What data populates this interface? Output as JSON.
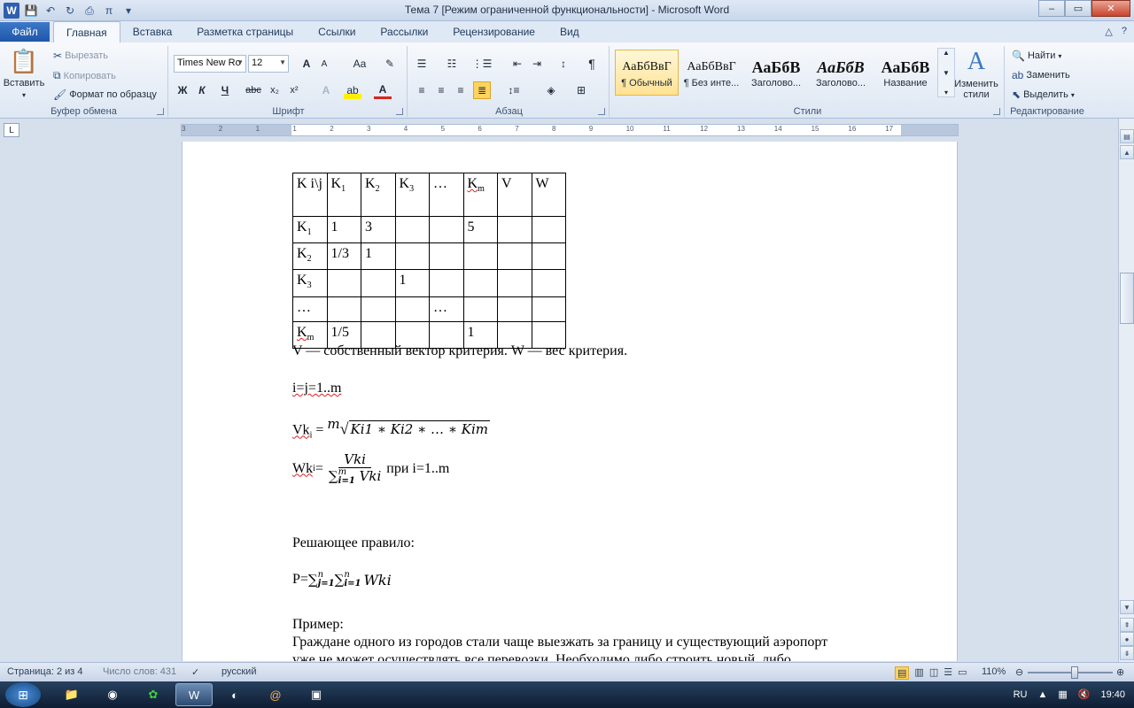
{
  "window": {
    "title": "Тема 7 [Режим ограниченной функциональности]  -  Microsoft Word",
    "minimize": "–",
    "maximize": "▭",
    "close": "✕"
  },
  "tabs": {
    "file": "Файл",
    "items": [
      "Главная",
      "Вставка",
      "Разметка страницы",
      "Ссылки",
      "Рассылки",
      "Рецензирование",
      "Вид"
    ],
    "active_index": 0
  },
  "ribbon": {
    "clipboard": {
      "label": "Буфер обмена",
      "paste": "Вставить",
      "cut": "Вырезать",
      "copy": "Копировать",
      "format_painter": "Формат по образцу"
    },
    "font": {
      "label": "Шрифт",
      "font_name": "Times New Ro",
      "font_size": "12",
      "bold": "Ж",
      "italic": "К",
      "underline": "Ч",
      "strike": "abc",
      "sub": "x₂",
      "sup": "x²",
      "grow": "A",
      "shrink": "A",
      "case": "Aa",
      "clear": "A"
    },
    "paragraph": {
      "label": "Абзац",
      "pilcrow": "¶"
    },
    "styles": {
      "label": "Стили",
      "items": [
        {
          "sample": "АаБбВвГ",
          "name": "¶ Обычный"
        },
        {
          "sample": "АаБбВвГ",
          "name": "¶ Без инте..."
        },
        {
          "sample": "АаБбВ",
          "name": "Заголово..."
        },
        {
          "sample": "АаБбВ",
          "name": "Заголово..."
        },
        {
          "sample": "АаБбВ",
          "name": "Название"
        }
      ],
      "selected_index": 0,
      "change_styles": "Изменить стили"
    },
    "editing": {
      "label": "Редактирование",
      "find": "Найти",
      "replace": "Заменить",
      "select": "Выделить"
    }
  },
  "ruler": {
    "numbers": [
      "3",
      "2",
      "1",
      "1",
      "2",
      "3",
      "4",
      "5",
      "6",
      "7",
      "8",
      "9",
      "10",
      "11",
      "12",
      "13",
      "14",
      "15",
      "16",
      "17"
    ]
  },
  "document": {
    "table": {
      "header": [
        "K i\\j",
        "K1",
        "K2",
        "K3",
        "…",
        "Km",
        "V",
        "W"
      ],
      "rows": [
        [
          "K1",
          "1",
          "3",
          "",
          "",
          "5",
          "",
          ""
        ],
        [
          "K2",
          "1/3",
          "1",
          "",
          "",
          "",
          "",
          ""
        ],
        [
          "K3",
          "",
          "",
          "1",
          "",
          "",
          "",
          ""
        ],
        [
          "…",
          "",
          "",
          "",
          "…",
          "",
          "",
          ""
        ],
        [
          "Km",
          "1/5",
          "",
          "",
          "",
          "1",
          "",
          ""
        ]
      ]
    },
    "caption": "V — собственный вектор критерия. W — вес критерия.",
    "range": "i=j=1..m",
    "vk_label": "Vk",
    "vk_sub": "i",
    "vk_root_index": "m",
    "vk_radicand": "Ki1 ∗ Ki2 ∗ … ∗ Kim",
    "wk_label": "Wk",
    "wk_sub": "i",
    "wk_num": "Vki",
    "wk_den": "∑ⁱ₌₁ᵐ Vki",
    "wk_den_sigma": "∑",
    "wk_den_sup": "m",
    "wk_den_sub": "i=1",
    "wk_den_var": "Vki",
    "wk_tail": " при i=1..m",
    "rule_title": "Решающее правило:",
    "p_label": "P=",
    "p_sum1_sup": "n",
    "p_sum1_sub": "j=1",
    "p_sum2_sup": "n",
    "p_sum2_sub": "i=1",
    "p_var": "Wki",
    "example_title": "Пример:",
    "example_line1": "Граждане одного из городов стали чаще выезжать за границу и существующий аэропорт",
    "example_line2": "уже не может осуществлять все перевозки. Необходимо либо строить новый, либо"
  },
  "status": {
    "page": "Страница: 2 из 4",
    "words": "Число слов: 431",
    "language": "русский",
    "zoom": "110%",
    "zoom_fraction": 0.55
  },
  "taskbar": {
    "lang": "RU",
    "time": "19:40"
  }
}
